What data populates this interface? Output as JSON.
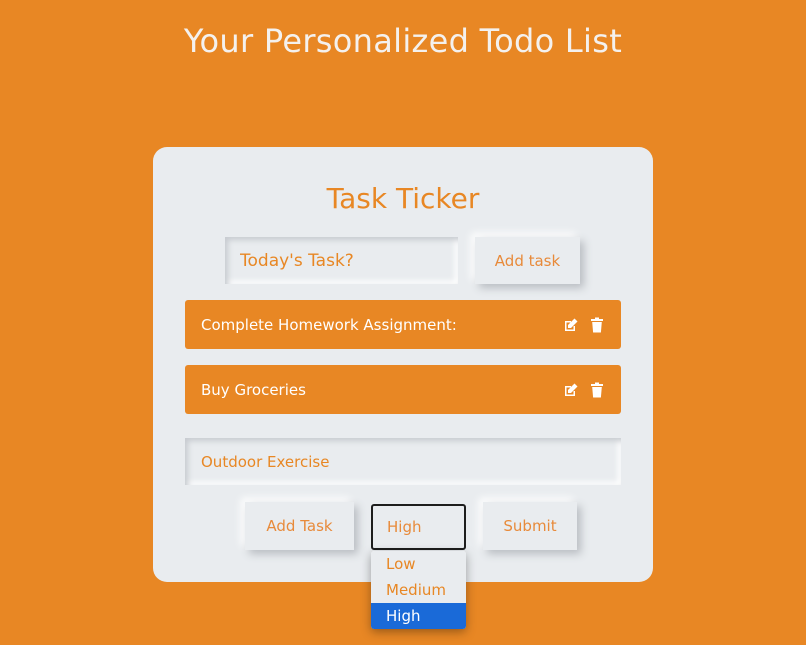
{
  "page": {
    "title": "Your Personalized Todo List"
  },
  "card": {
    "title": "Task Ticker",
    "new_task_placeholder": "Today's Task?",
    "add_task_button": "Add task"
  },
  "tasks": [
    {
      "label": "Complete Homework Assignment:",
      "edit_icon": "edit-icon",
      "delete_icon": "trash-icon"
    },
    {
      "label": "Buy Groceries",
      "edit_icon": "edit-icon",
      "delete_icon": "trash-icon"
    }
  ],
  "editor": {
    "task_value": "Outdoor Exercise",
    "add_task_button": "Add Task",
    "priority_selected": "High",
    "priority_options": [
      "Low",
      "Medium",
      "High"
    ],
    "submit_button": "Submit"
  },
  "colors": {
    "background": "#e88724",
    "card": "#e9ecef",
    "accent": "#e88724",
    "selected_option": "#1a6ad8"
  }
}
